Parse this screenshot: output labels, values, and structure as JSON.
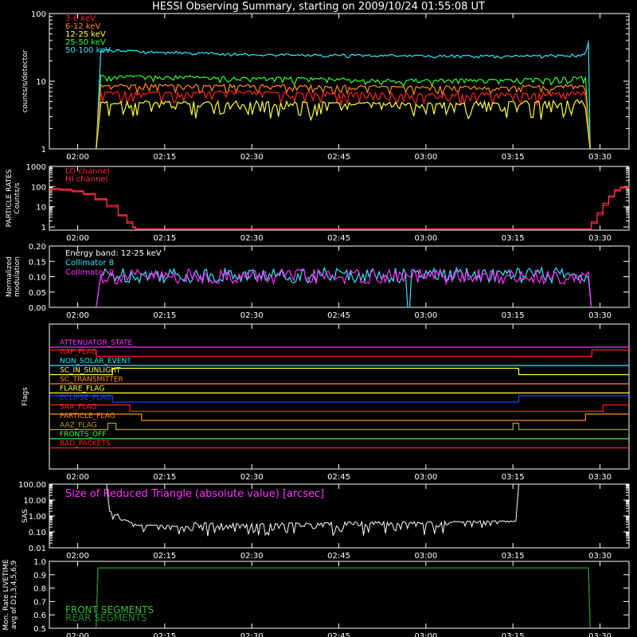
{
  "title": "HESSI Observing Summary, starting on 2009/10/24 01:55:08 UT",
  "colors": {
    "background": "#000000",
    "axes": "#ffffff",
    "band_3_6": "#ff2020",
    "band_6_12": "#ff8c1a",
    "band_12_25": "#ffff30",
    "band_25_50": "#30ff30",
    "band_50_100": "#30e8ff",
    "lo_channel": "#ff2020",
    "hi_channel": "#ff3060",
    "collimator_8": "#30e8ff",
    "collimator_9": "#ff30ff",
    "sas": "#ffffff",
    "sas_label": "#ff30ff",
    "front_segments": "#30c030",
    "rear_segments": "#208a20"
  },
  "chart_data": [
    {
      "type": "line",
      "panel": "count rates",
      "ylabel": "counts/s/detector",
      "ylog": true,
      "ylim": [
        1,
        100
      ],
      "y_ticks": [
        "1",
        "10",
        "100"
      ],
      "x_ticks": [
        "02:00",
        "02:15",
        "02:30",
        "02:45",
        "03:00",
        "03:15",
        "03:30"
      ],
      "x_range_minutes": [
        115.13,
        215.0
      ],
      "legend_position": "top-left",
      "series": [
        {
          "name": "3-6 keV",
          "color_key": "band_3_6",
          "x": [
            123.2,
            124.0,
            150,
            180,
            200,
            207.5,
            208.3
          ],
          "y": [
            1,
            7.0,
            7.0,
            6.5,
            6.8,
            7.0,
            1
          ]
        },
        {
          "name": "6-12 keV",
          "color_key": "band_6_12",
          "x": [
            123.2,
            124.0,
            150,
            180,
            200,
            207.5,
            208.3
          ],
          "y": [
            1,
            9.0,
            8.8,
            8.3,
            8.6,
            8.8,
            1
          ]
        },
        {
          "name": "12-25 keV",
          "color_key": "band_12_25",
          "x": [
            123.2,
            124.0,
            150,
            180,
            200,
            207.5,
            208.3
          ],
          "y": [
            1,
            5.0,
            5.0,
            4.8,
            5.0,
            5.2,
            1
          ]
        },
        {
          "name": "25-50 keV",
          "color_key": "band_25_50",
          "x": [
            123.2,
            124.0,
            150,
            180,
            200,
            207.5,
            208.3
          ],
          "y": [
            1,
            12.0,
            11.5,
            10.5,
            11.0,
            11.5,
            1
          ]
        },
        {
          "name": "50-100 keV",
          "color_key": "band_50_100",
          "x": [
            123.2,
            124.0,
            150,
            180,
            200,
            207.5,
            208.0,
            208.3
          ],
          "y": [
            1,
            29,
            25,
            24,
            24,
            25,
            40,
            1
          ]
        }
      ]
    },
    {
      "type": "line",
      "panel": "particle rates",
      "ylabel": "PARTICLE RATES Counts/s",
      "ylog": true,
      "ylim": [
        0.7,
        1000
      ],
      "y_ticks": [
        "1",
        "10",
        "100",
        "1000"
      ],
      "x_ticks": [
        "02:00",
        "02:15",
        "02:30",
        "02:45",
        "03:00",
        "03:15",
        "03:30"
      ],
      "legend_position": "top-left",
      "series": [
        {
          "name": "LO channel",
          "color_key": "lo_channel",
          "x": [
            115.2,
            117,
            119,
            121,
            123,
            125,
            127,
            128.5,
            129.5,
            130,
            131,
            205,
            207.5,
            208.5,
            209.5,
            210.5,
            211.5,
            212.5,
            213.5,
            215
          ],
          "y": [
            70,
            65,
            55,
            40,
            22,
            10,
            3.5,
            1.5,
            0.9,
            0.8,
            0.8,
            0.8,
            0.8,
            1.5,
            4,
            12,
            30,
            60,
            85,
            90
          ]
        },
        {
          "name": "HI channel",
          "color_key": "hi_channel",
          "x": [
            115.2,
            117,
            119,
            121,
            123,
            125,
            127,
            128.5,
            129.5,
            130,
            131,
            205,
            207.5,
            208.5,
            209.5,
            210.5,
            211.5,
            212.5,
            213.5,
            215
          ],
          "y": [
            80,
            75,
            62,
            45,
            25,
            12,
            4,
            1.8,
            1,
            0.8,
            0.8,
            0.8,
            0.8,
            1.8,
            5,
            15,
            35,
            70,
            95,
            100
          ]
        }
      ]
    },
    {
      "type": "line",
      "panel": "modulation",
      "ylabel": "Normalized modulation",
      "ylim": [
        0.0,
        0.2
      ],
      "y_ticks": [
        "0.00",
        "0.05",
        "0.10",
        "0.15",
        "0.20"
      ],
      "x_ticks": [
        "02:00",
        "02:15",
        "02:30",
        "02:45",
        "03:00",
        "03:15",
        "03:30"
      ],
      "annotation": "Energy band: 12-25 keV",
      "legend_position": "top-left",
      "series": [
        {
          "name": "Collimator 8",
          "color_key": "collimator_8",
          "x": [
            123.2,
            124.0,
            160,
            176.5,
            177,
            177.5,
            208.0,
            208.5
          ],
          "y": [
            0,
            0.105,
            0.105,
            0.105,
            0.0,
            0.105,
            0.105,
            0
          ]
        },
        {
          "name": "Collimator 9",
          "color_key": "collimator_9",
          "x": [
            123.2,
            124.0,
            160,
            208.0,
            208.5
          ],
          "y": [
            0,
            0.1,
            0.1,
            0.1,
            0
          ]
        }
      ]
    },
    {
      "type": "line",
      "panel": "flags",
      "ylabel": "Flags",
      "x_ticks": [
        "02:00",
        "02:15",
        "02:30",
        "02:45",
        "03:00",
        "03:15",
        "03:30"
      ],
      "flags": [
        {
          "name": "ATTENUATOR_STATE",
          "color": "#ff30ff",
          "transitions": []
        },
        {
          "name": "GAP_FLAG",
          "color": "#ff2020",
          "transitions": [
            [
              115.2,
              1
            ],
            [
              123.2,
              0
            ],
            [
              208.6,
              1
            ]
          ]
        },
        {
          "name": "NON_SOLAR_EVENT",
          "color": "#30e8ff",
          "transitions": []
        },
        {
          "name": "SC_IN_SUNLIGHT",
          "color": "#ffff30",
          "transitions": [
            [
              115.2,
              0
            ],
            [
              126.0,
              1
            ],
            [
              196.0,
              0
            ]
          ]
        },
        {
          "name": "SC_TRANSMITTER",
          "color": "#ff8c1a",
          "transitions": []
        },
        {
          "name": "FLARE_FLAG",
          "color": "#ffff30",
          "transitions": []
        },
        {
          "name": "ECLIPSE_FLAG",
          "color": "#2040ff",
          "transitions": [
            [
              115.2,
              1
            ],
            [
              126.0,
              0
            ],
            [
              196.0,
              1
            ]
          ]
        },
        {
          "name": "SAA_FLAG",
          "color": "#ff2020",
          "transitions": [
            [
              115.2,
              1
            ],
            [
              129.0,
              0
            ],
            [
              210.5,
              1
            ]
          ]
        },
        {
          "name": "PARTICLE_FLAG",
          "color": "#ff8c1a",
          "transitions": [
            [
              115.2,
              1
            ],
            [
              131.0,
              0
            ],
            [
              207.5,
              1
            ]
          ]
        },
        {
          "name": "AAZ_FLAG",
          "color": "#b0a030",
          "transitions": [
            [
              115.2,
              0
            ],
            [
              125.2,
              1
            ],
            [
              126.6,
              0
            ],
            [
              195.0,
              1
            ],
            [
              196.0,
              0
            ]
          ]
        },
        {
          "name": "FRONTS_OFF",
          "color": "#30ff30",
          "transitions": []
        },
        {
          "name": "BAD_PACKETS",
          "color": "#ff2020",
          "transitions": []
        }
      ]
    },
    {
      "type": "line",
      "panel": "SAS",
      "ylabel": "SAS",
      "ylog": true,
      "ylim": [
        0.01,
        100
      ],
      "y_ticks": [
        "0.01",
        "0.10",
        "1.00",
        "10.00",
        "100.00"
      ],
      "x_ticks": [
        "02:00",
        "02:15",
        "02:30",
        "02:45",
        "03:00",
        "03:15",
        "03:30"
      ],
      "annotation": "Size of Reduced Triangle (absolute value) [arcsec]",
      "series": [
        {
          "name": "",
          "color_key": "sas",
          "x": [
            125.0,
            125.5,
            126.0,
            130,
            140,
            150,
            160,
            170,
            180,
            190,
            195.5,
            196.0
          ],
          "y": [
            100,
            3.0,
            1.5,
            0.5,
            0.35,
            0.3,
            0.35,
            0.4,
            0.4,
            0.45,
            0.45,
            100
          ]
        }
      ]
    },
    {
      "type": "line",
      "panel": "livetime",
      "ylabel": "Mon. Rate LIVETIME avg of D1,3,4,5,6,9",
      "ylim": [
        0.5,
        1.0
      ],
      "y_ticks": [
        "0.5",
        "0.6",
        "0.7",
        "0.8",
        "0.9",
        "1.0"
      ],
      "x_ticks": [
        "02:00",
        "02:15",
        "02:30",
        "02:45",
        "03:00",
        "03:15",
        "03:30"
      ],
      "legend_position": "bottom-left",
      "series": [
        {
          "name": "FRONT SEGMENTS",
          "color_key": "front_segments",
          "x": [
            123.2,
            123.5,
            208.0,
            208.3
          ],
          "y": [
            0.5,
            0.95,
            0.95,
            0.5
          ]
        },
        {
          "name": "REAR SEGMENTS",
          "color_key": "rear_segments",
          "x": [
            123.2,
            123.5,
            208.0,
            208.3
          ],
          "y": [
            0.5,
            0.95,
            0.95,
            0.5
          ]
        }
      ]
    }
  ]
}
